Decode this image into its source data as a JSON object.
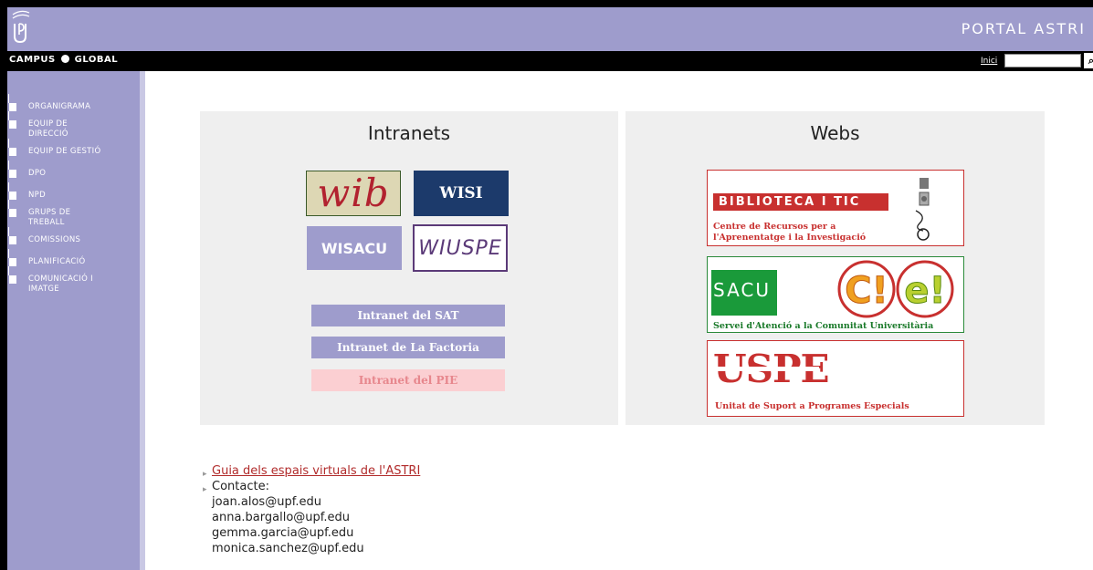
{
  "header": {
    "portal_title": "PORTAL ASTRI",
    "campus_left": "CAMPUS",
    "campus_right": "GLOBAL",
    "inici_label": "Inici",
    "search_placeholder": ""
  },
  "sidebar": {
    "items": [
      {
        "label": "ORGANIGRAMA"
      },
      {
        "label": "EQUIP DE DIRECCIÓ"
      },
      {
        "label": "EQUIP DE GESTIÓ"
      },
      {
        "label": "DPO"
      },
      {
        "label": "NPD"
      },
      {
        "label": "GRUPS DE TREBALL"
      },
      {
        "label": "COMISSIONS"
      },
      {
        "label": "PLANIFICACIÓ"
      },
      {
        "label": "COMUNICACIÓ I IMATGE"
      }
    ]
  },
  "intranets": {
    "title": "Intranets",
    "tiles": {
      "wib": "wib",
      "wisi": "WISI",
      "wisacu": "WISACU",
      "wiuspe": "WIUSPE"
    },
    "buttons": {
      "sat": "Intranet del SAT",
      "factoria": "Intranet de La Factoria",
      "pie": "Intranet del PIE"
    }
  },
  "webs": {
    "title": "Webs",
    "biblioteca": {
      "title": "BIBLIOTECA I TIC",
      "subtitle_line1": "Centre de Recursos per a",
      "subtitle_line2": "l'Aprenentatge i la Investigació"
    },
    "sacu": {
      "label": "SACU",
      "subtitle": "Servei d'Atenció a la Comunitat Universitària"
    },
    "uspe": {
      "logo": "USPE",
      "subtitle": "Unitat de Suport a Programes Especials"
    }
  },
  "footer": {
    "guide_link": "Guia dels espais virtuals de l'ASTRI",
    "contact_label": "Contacte:",
    "emails": [
      "joan.alos@upf.edu",
      "anna.bargallo@upf.edu",
      "gemma.garcia@upf.edu",
      "monica.sanchez@upf.edu"
    ]
  },
  "colors": {
    "lavender": "#9e9ccc",
    "upf_red": "#c8302f",
    "sacu_green": "#1a9a3a",
    "wisi_navy": "#1c3a6b"
  }
}
